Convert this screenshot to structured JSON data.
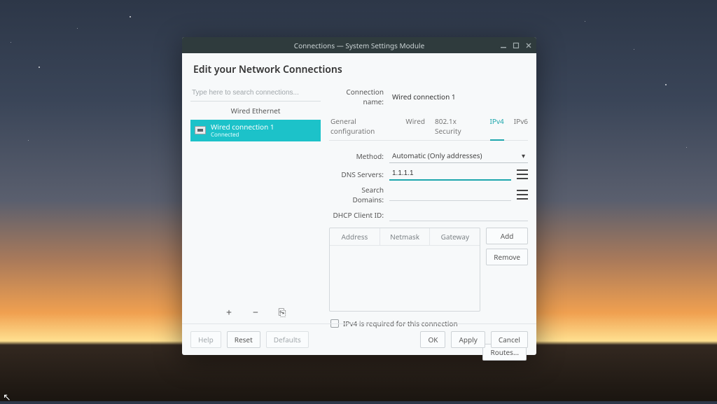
{
  "window": {
    "title": "Connections — System Settings Module"
  },
  "page": {
    "title": "Edit your Network Connections"
  },
  "sidebar": {
    "search_placeholder": "Type here to search connections...",
    "group_label": "Wired Ethernet",
    "connection": {
      "name": "Wired connection 1",
      "status": "Connected"
    },
    "buttons": {
      "add": "+",
      "remove": "−",
      "export": "⎘"
    }
  },
  "details": {
    "connection_name_label": "Connection name:",
    "connection_name_value": "Wired connection 1",
    "tabs": {
      "general": "General configuration",
      "wired": "Wired",
      "security": "802.1x Security",
      "ipv4": "IPv4",
      "ipv6": "IPv6"
    },
    "ipv4": {
      "method_label": "Method:",
      "method_value": "Automatic (Only addresses)",
      "dns_label": "DNS Servers:",
      "dns_value": "1.1.1.1",
      "search_label": "Search Domains:",
      "search_value": "",
      "dhcp_label": "DHCP Client ID:",
      "dhcp_value": "",
      "columns": {
        "address": "Address",
        "netmask": "Netmask",
        "gateway": "Gateway"
      },
      "add_btn": "Add",
      "remove_btn": "Remove",
      "required_label": "IPv4 is required for this connection",
      "routes_btn": "Routes..."
    }
  },
  "footer": {
    "help": "Help",
    "reset": "Reset",
    "defaults": "Defaults",
    "ok": "OK",
    "apply": "Apply",
    "cancel": "Cancel"
  }
}
